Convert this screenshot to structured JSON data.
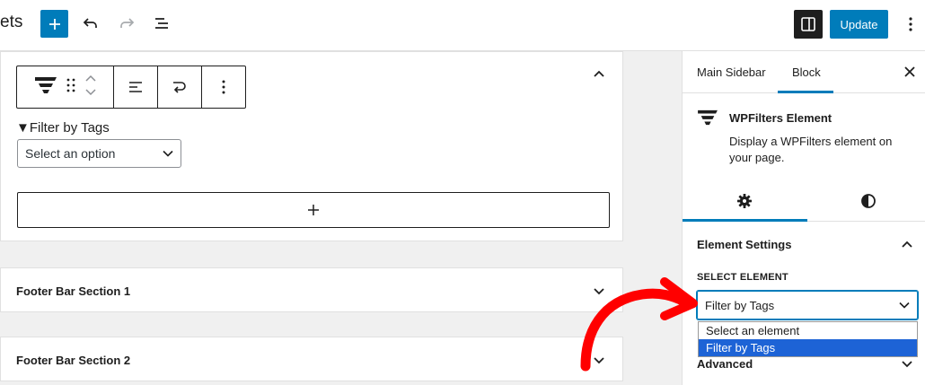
{
  "header": {
    "title_partial": "ets",
    "add_icon": "plus-icon",
    "undo_icon": "undo-icon",
    "redo_icon": "redo-icon",
    "list_view_icon": "list-view-icon",
    "settings_toggle_icon": "sidebar-toggle-icon",
    "update_label": "Update",
    "more_icon": "kebab-menu-icon"
  },
  "editor": {
    "block": {
      "toolbar_icons": [
        "wpfilters-logo-icon",
        "drag-handle-icon",
        "move-up-down-icon",
        "align-icon",
        "transform-icon",
        "more-options-icon"
      ],
      "filter_label": "▼Filter by Tags",
      "select_value": "Select an option",
      "appender_icon": "plus-icon"
    },
    "sections": [
      {
        "title": "Footer Bar Section 1"
      },
      {
        "title": "Footer Bar Section 2"
      }
    ]
  },
  "sidebar": {
    "tabs": [
      {
        "label": "Main Sidebar",
        "active": false
      },
      {
        "label": "Block",
        "active": true
      }
    ],
    "close_icon": "close-icon",
    "block_info": {
      "title": "WPFilters Element",
      "description": "Display a WPFilters element on your page."
    },
    "sub_tabs": [
      "settings-gear-icon",
      "styles-contrast-icon"
    ],
    "panel": {
      "title": "Element Settings",
      "select_label": "SELECT ELEMENT",
      "select_value": "Filter by Tags",
      "options": [
        {
          "label": "Select an element",
          "selected": false
        },
        {
          "label": "Filter by Tags",
          "selected": true
        }
      ]
    },
    "advanced_label": "Advanced"
  },
  "colors": {
    "accent": "#007cba",
    "annotation_arrow": "#ff0000",
    "dropdown_highlight": "#1d63d6"
  }
}
